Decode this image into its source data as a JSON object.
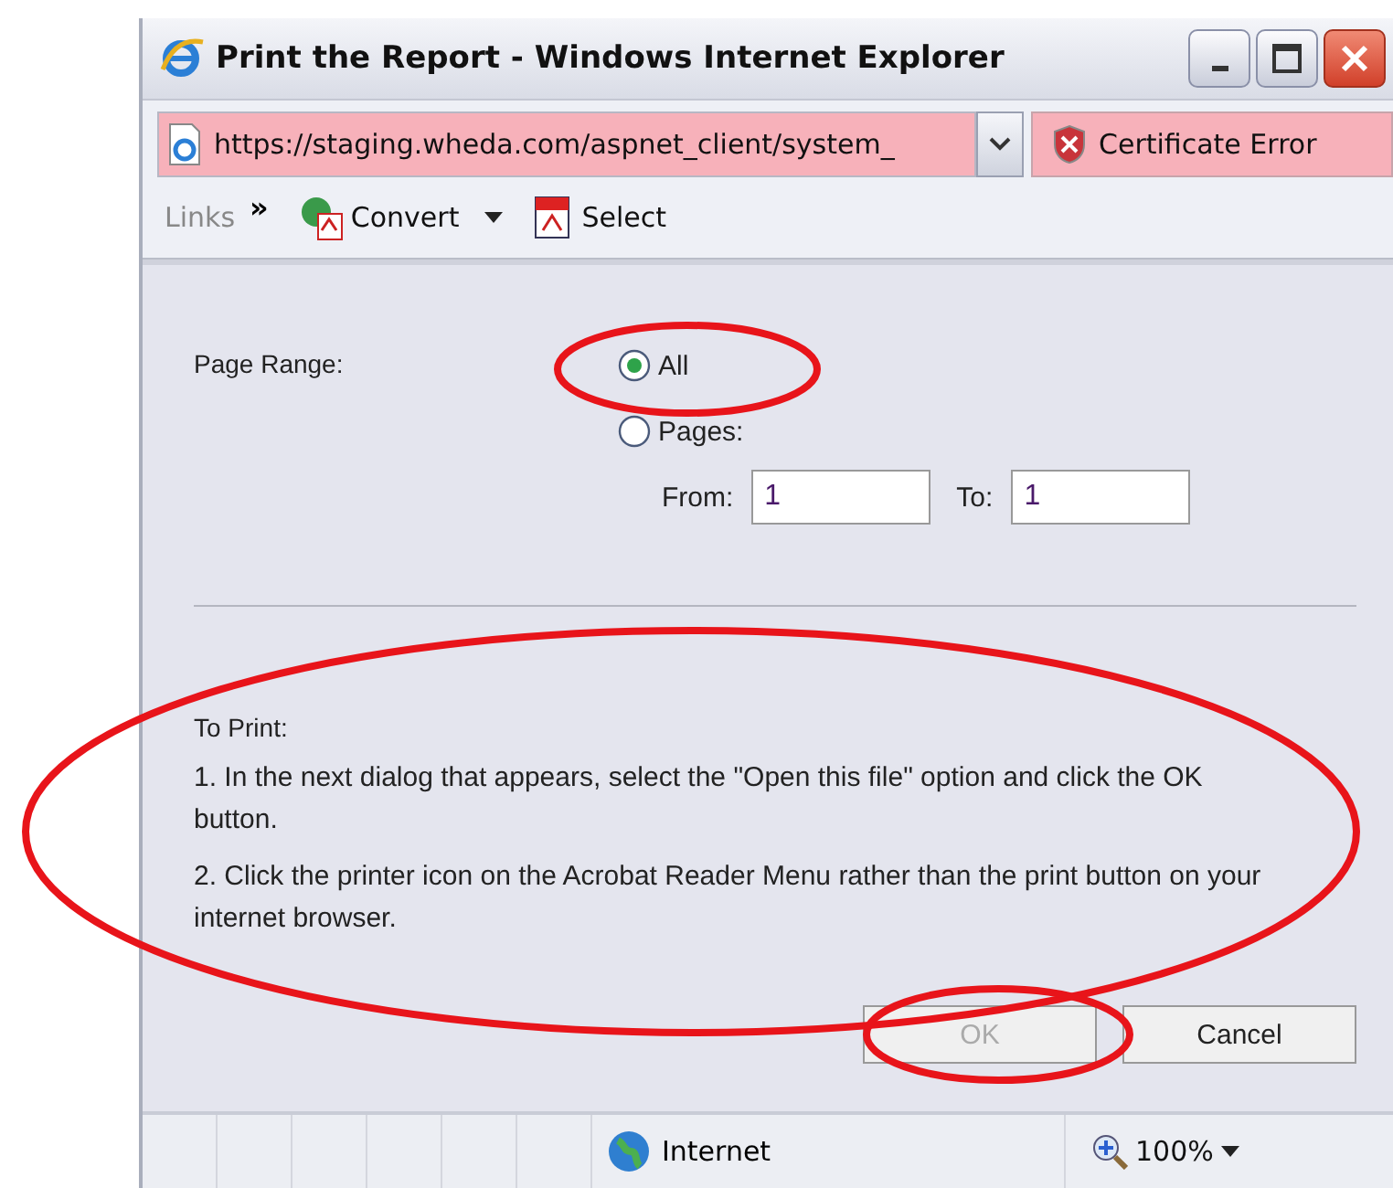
{
  "window": {
    "title": "Print the Report - Windows Internet Explorer"
  },
  "address_bar": {
    "url": "https://staging.wheda.com/aspnet_client/system_",
    "certificate": "Certificate Error"
  },
  "links_bar": {
    "label": "Links",
    "chevron": "»",
    "items": [
      {
        "label": "Convert",
        "kind": "convert"
      },
      {
        "label": "Select",
        "kind": "select"
      }
    ]
  },
  "form": {
    "label": "Page Range:",
    "options": [
      {
        "label": "All",
        "selected": true
      },
      {
        "label": "Pages:",
        "selected": false
      }
    ],
    "from_label": "From:",
    "from_value": "1",
    "to_label": "To:",
    "to_value": "1"
  },
  "instructions": {
    "heading": "To Print:",
    "steps": [
      "1. In the next dialog that appears, select the \"Open this file\" option and click the OK button.",
      "2. Click the printer icon on the Acrobat Reader Menu rather than the print button on your internet browser."
    ]
  },
  "buttons": [
    {
      "label": "OK",
      "disabled": true
    },
    {
      "label": "Cancel",
      "disabled": false
    }
  ],
  "status_bar": {
    "zone": "Internet",
    "zoom": "100%"
  }
}
